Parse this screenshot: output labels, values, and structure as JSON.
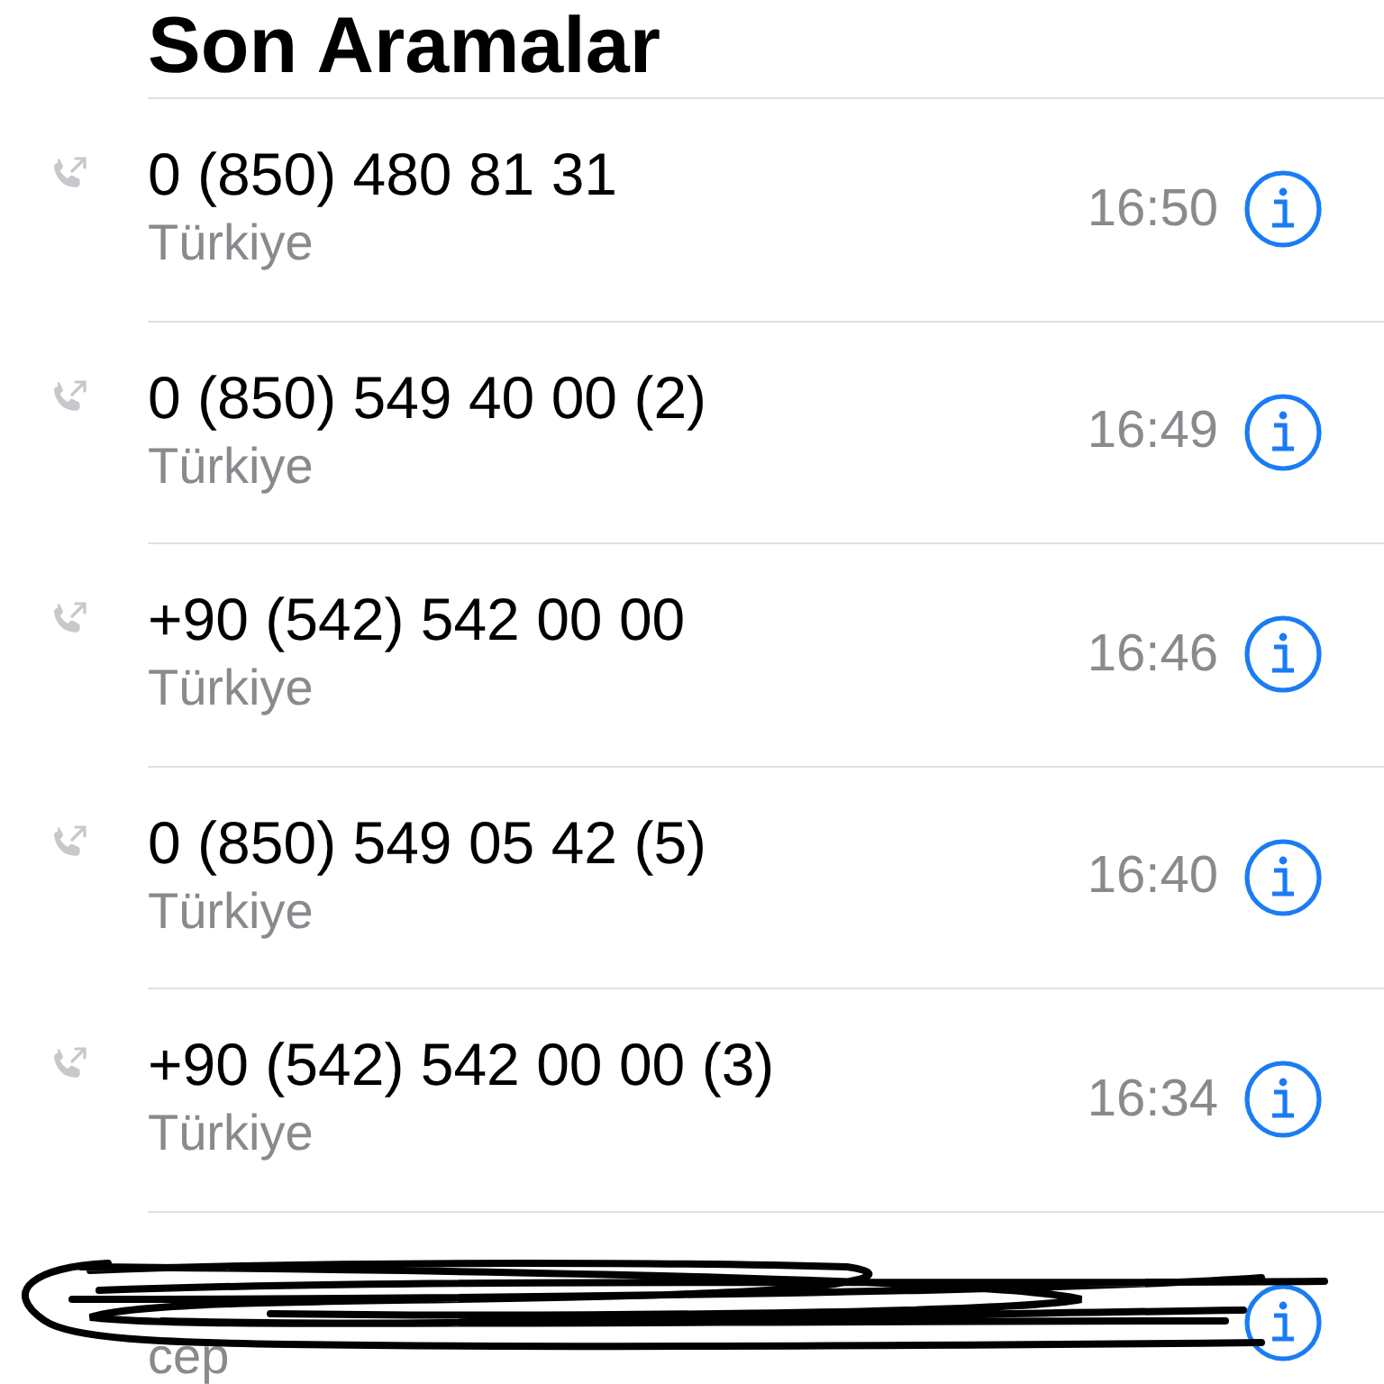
{
  "title": "Son Aramalar",
  "calls": [
    {
      "kind": "call",
      "number": "0 (850) 480 81 31",
      "label": "Türkiye",
      "time": "16:50"
    },
    {
      "kind": "call",
      "number": "0 (850) 549 40 00 (2)",
      "label": "Türkiye",
      "time": "16:49"
    },
    {
      "kind": "call",
      "number": "+90 (542) 542 00 00",
      "label": "Türkiye",
      "time": "16:46"
    },
    {
      "kind": "call",
      "number": "0 (850) 549 05 42 (5)",
      "label": "Türkiye",
      "time": "16:40"
    },
    {
      "kind": "call",
      "number": "+90 (542) 542 00 00 (3)",
      "label": "Türkiye",
      "time": "16:34"
    },
    {
      "kind": "redacted",
      "label": "cep"
    }
  ]
}
